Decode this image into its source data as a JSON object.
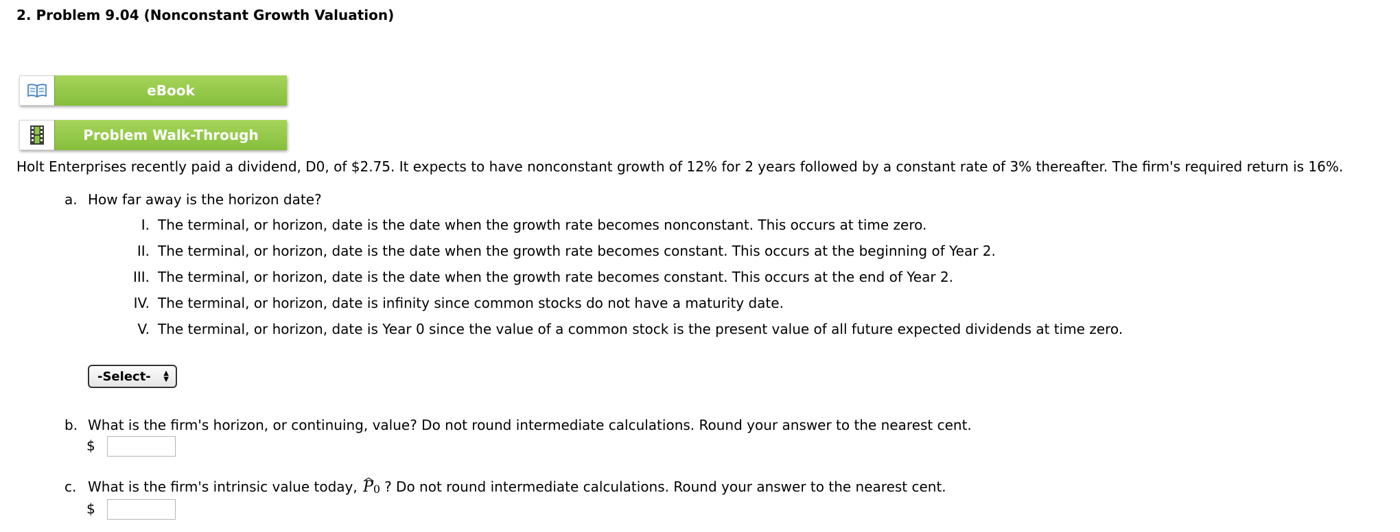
{
  "problem": {
    "title": "2. Problem 9.04 (Nonconstant Growth Valuation)"
  },
  "resources": {
    "ebook": {
      "label": "eBook",
      "icon": "book-icon"
    },
    "walkthrough": {
      "label": "Problem Walk-Through",
      "icon": "film-icon"
    }
  },
  "intro": {
    "before": "Holt Enterprises recently paid a dividend, D",
    "sub": "0",
    "after": ", of $2.75. It expects to have nonconstant growth of 12% for 2 years followed by a constant rate of 3% thereafter. The firm's required return is 16%."
  },
  "question_a": {
    "letter": "a.",
    "text": "How far away is the horizon date?",
    "options": [
      {
        "num": "I.",
        "text": "The terminal, or horizon, date is the date when the growth rate becomes nonconstant. This occurs at time zero."
      },
      {
        "num": "II.",
        "text": "The terminal, or horizon, date is the date when the growth rate becomes constant. This occurs at the beginning of Year 2."
      },
      {
        "num": "III.",
        "text": "The terminal, or horizon, date is the date when the growth rate becomes constant. This occurs at the end of Year 2."
      },
      {
        "num": "IV.",
        "text": "The terminal, or horizon, date is infinity since common stocks do not have a maturity date."
      },
      {
        "num": "V.",
        "text": "The terminal, or horizon, date is Year 0 since the value of a common stock is the present value of all future expected dividends at time zero."
      }
    ],
    "select_value": "-Select-"
  },
  "question_b": {
    "letter": "b.",
    "text": "What is the firm's horizon, or continuing, value? Do not round intermediate calculations. Round your answer to the nearest cent.",
    "currency": "$",
    "value": ""
  },
  "question_c": {
    "letter": "c.",
    "text_before": "What is the firm's intrinsic value today,",
    "symbol": "P",
    "symbol_sub": "0",
    "text_after": "? Do not round intermediate calculations. Round your answer to the nearest cent.",
    "currency": "$",
    "value": ""
  }
}
